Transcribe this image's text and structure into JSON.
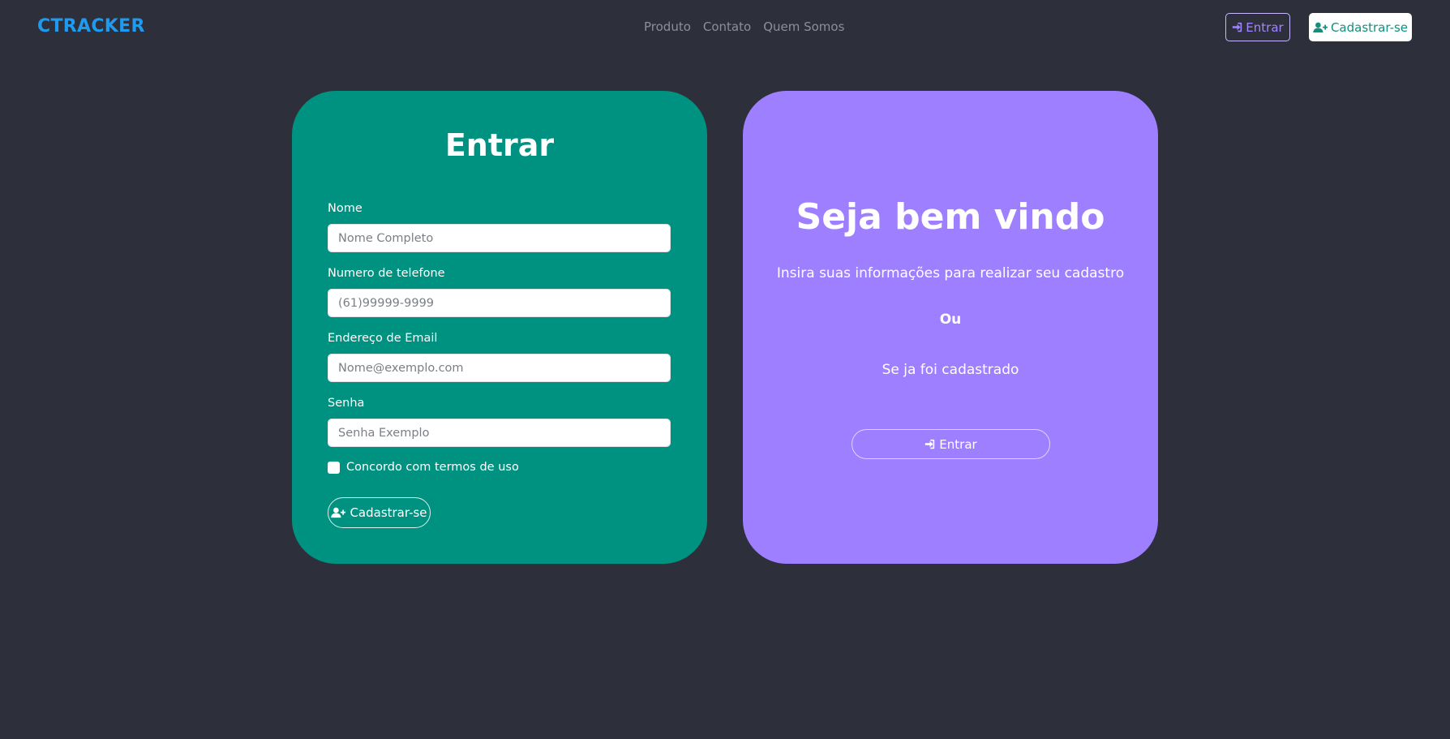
{
  "navbar": {
    "brand": "CTRACKER",
    "links": [
      "Produto",
      "Contato",
      "Quem Somos"
    ],
    "login_label": "Entrar",
    "signup_label": "Cadastrar-se"
  },
  "form": {
    "title": "Entrar",
    "fields": [
      {
        "label": "Nome",
        "placeholder": "Nome Completo"
      },
      {
        "label": "Numero de telefone",
        "placeholder": "(61)99999-9999"
      },
      {
        "label": "Endereço de Email",
        "placeholder": "Nome@exemplo.com"
      },
      {
        "label": "Senha",
        "placeholder": "Senha Exemplo"
      }
    ],
    "terms_label": "Concordo com termos de uso",
    "submit_label": "Cadastrar-se"
  },
  "welcome": {
    "title": "Seja bem vindo",
    "text": "Insira suas informações para realizar seu cadastro",
    "or": "Ou",
    "sub": "Se ja foi cadastrado",
    "login_label": "Entrar"
  },
  "colors": {
    "background": "#2d303b",
    "brand": "#1e9bf0",
    "green_card": "#009280",
    "purple_card": "#9e7fff"
  }
}
